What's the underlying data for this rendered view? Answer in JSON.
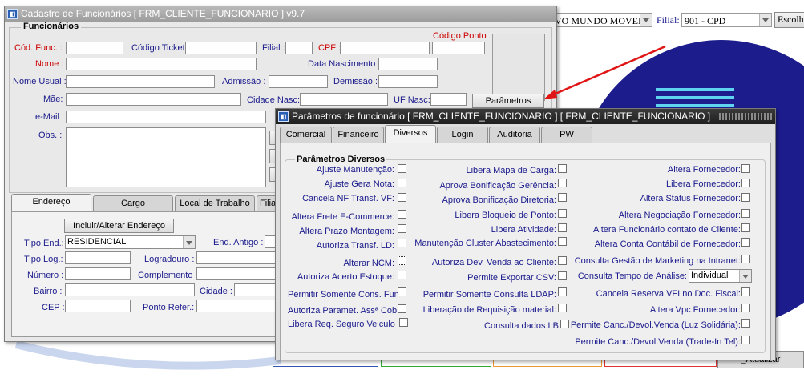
{
  "background": {
    "company_value": "VO MUNDO MOVEIS",
    "filial_label": "Filial:",
    "filial_value": "901 - CPD",
    "choose_button": "Escolh",
    "bottom_button": "_Atualizar",
    "accent_circle": "#1c1c8c"
  },
  "cad_window": {
    "title": "Cadastro de Funcionários [ FRM_CLIENTE_FUNCIONARIO ] v9.7",
    "section_title": "Funcionários",
    "cod_func_label": "Cód. Func. :",
    "codigo_ticket_label": "Código Ticket:",
    "filial_label": "Filial :",
    "cpf_label": "CPF :",
    "codigo_ponto_label": "Código Ponto",
    "nome_label": "Nome :",
    "data_nasc_label": "Data Nascimento :",
    "nome_usual_label": "Nome Usual :",
    "admissao_label": "Admissão :",
    "demissao_label": "Demissão :",
    "mae_label": "Mãe:",
    "cidade_nasc_label": "Cidade Nasc:",
    "uf_nasc_label": "UF Nasc:",
    "parametros_button": "Parâmetros",
    "email_label": "e-Mail :",
    "obs_label": "Obs. :",
    "tabs": [
      "Endereço",
      "Cargo",
      "Local de Trabalho",
      "Filia"
    ],
    "incluir_button": "Incluir/Alterar Endereço",
    "tipo_end_label": "Tipo End.:",
    "tipo_end_value": "RESIDENCIAL",
    "end_antigo_label": "End. Antigo :",
    "tipo_log_label": "Tipo Log.:",
    "logradouro_label": "Logradouro :",
    "numero_label": "Número :",
    "complemento_label": "Complemento :",
    "bairro_label": "Bairro :",
    "cidade_label": "Cidade :",
    "cep_label": "CEP :",
    "ponto_refer_label": "Ponto Refer.:"
  },
  "param_window": {
    "title": "Parâmetros de funcionário [ FRM_CLIENTE_FUNCIONARIO ] [ FRM_CLIENTE_FUNCIONARIO ]",
    "tabs": [
      "Comercial",
      "Financeiro",
      "Diversos",
      "Login",
      "Auditoria",
      "PW"
    ],
    "group_title": "Parâmetros Diversos",
    "col1": [
      "Ajuste Manutenção:",
      "Ajuste Gera Nota:",
      "Cancela NF Transf. VF:",
      "Altera Frete E-Commerce:",
      "Altera Prazo Montagem:",
      "Autoriza Transf. LD:",
      "Alterar NCM:",
      "Autoriza Acerto Estoque:",
      "Permitir Somente Cons. Fund",
      "Autoriza Paramet. Assª Cob",
      "Libera Req. Seguro Veiculo"
    ],
    "col2": [
      "Libera Mapa de Carga:",
      "Aprova Bonificação Gerência:",
      "Aprova Bonificação Diretoria:",
      "Libera Bloqueio de Ponto:",
      "Libera Atividade:",
      "Manutenção Cluster Abastecimento:",
      "Autoriza Dev. Venda ao Cliente:",
      "Permite Exportar CSV:",
      "Permitir Somente Consulta LDAP:",
      "Liberação de Requisição material:",
      "Consulta dados LB"
    ],
    "col3": [
      "Altera Fornecedor:",
      "Libera Fornecedor:",
      "Altera Status Fornecedor:",
      "Altera Negociação Fornecedor:",
      "Altera Funcionário contato de Cliente:",
      "Altera Conta Contábil de Fornecedor:",
      "Consulta Gestão de Marketing na Intranet:",
      "Consulta Tempo de Análise:",
      "Cancela Reserva VFI no Doc. Fiscal:",
      "Altera Vpc Fornecedor:",
      "Permite Canc./Devol.Venda (Luz Solidária):",
      "Permite Canc./Devol.Venda (Trade-In Tel):"
    ],
    "tempo_analise_value": "Individual"
  }
}
